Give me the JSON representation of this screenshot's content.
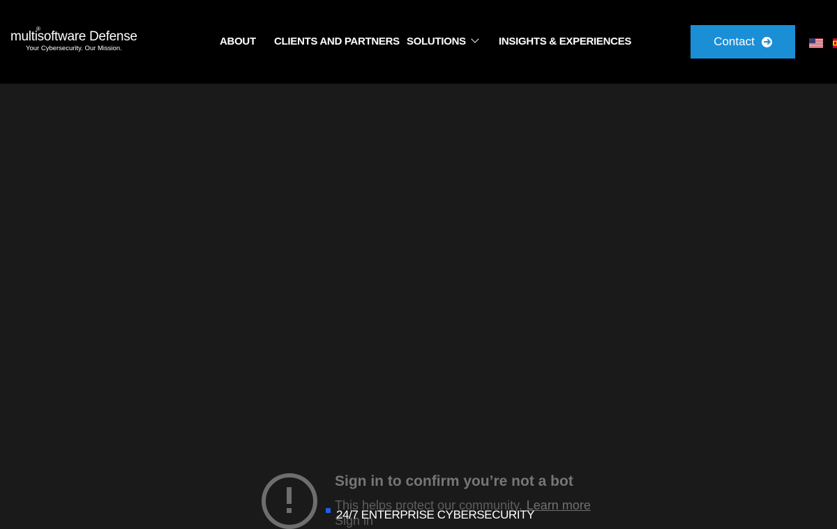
{
  "header": {
    "logo": {
      "name": "multisoftware Defense",
      "registered": "®",
      "tagline": "Your Cybersecurity. Our Mission."
    },
    "nav": [
      {
        "label": "ABOUT"
      },
      {
        "label": "CLIENTS AND PARTNERS"
      },
      {
        "label": "SOLUTIONS",
        "icon": "chevron-down-icon"
      },
      {
        "label": "INSIGHTS & EXPERIENCES"
      }
    ],
    "contact": {
      "label": "Contact",
      "icon": "arrow-right-circle-icon",
      "color": "#1a8fd6"
    },
    "languages": [
      "us-flag-icon",
      "es-flag-icon"
    ]
  },
  "embed": {
    "title": "Sign in to confirm you’re not a bot",
    "subtitle": "This helps protect our community.",
    "learn_more": "Learn more",
    "sign_in": "Sign in",
    "icon": "exclamation-circle-icon"
  },
  "badge": {
    "label": "24/7 ENTERPRISE CYBERSECURITY",
    "accent": "#1f5ee8"
  },
  "colors": {
    "header_bg": "#000000",
    "page_bg": "#1a1a1a"
  }
}
